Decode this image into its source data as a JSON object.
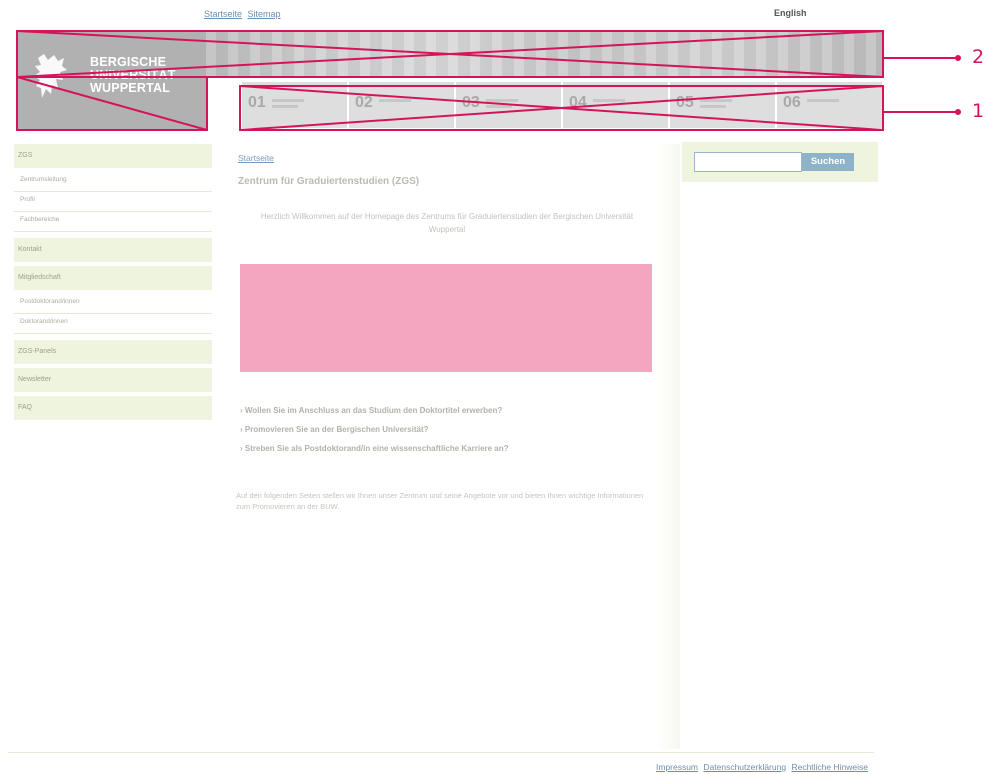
{
  "top_links": [
    "Startseite",
    "Sitemap"
  ],
  "language": "English",
  "logo": {
    "line1": "BERGISCHE",
    "line2": "UNIVERSITÄT",
    "line3": "WUPPERTAL"
  },
  "nav_tabs": [
    "01",
    "02",
    "03",
    "04",
    "05",
    "06"
  ],
  "annotations": {
    "label_1": "1",
    "label_2": "2",
    "color": "#d4145a"
  },
  "sidebar": {
    "items": [
      "ZGS",
      "Kontakt",
      "Mitgliedschaft",
      "ZGS-Panels",
      "Newsletter",
      "FAQ"
    ],
    "sub_zgs": [
      "Zentrumsleitung",
      "Profil",
      "Fachbereiche"
    ],
    "sub_mitgliedschaft": [
      "Postdoktorand/innen",
      "Doktorand/innen"
    ]
  },
  "main": {
    "breadcrumb": "Startseite",
    "title": "Zentrum für Graduiertenstudien (ZGS)",
    "welcome": "Herzlich Willkommen auf der Homepage des Zentrums für Graduiertenstudien der Bergischen Universität Wuppertal",
    "questions": [
      "Wollen Sie im Anschluss an das Studium den Doktortitel erwerben?",
      "Promovieren Sie an der Bergischen Universität?",
      "Streben Sie als Postdoktorand/in eine wissenschaftliche Karriere an?"
    ],
    "intro": "Auf den folgenden Seiten stellen wir Ihnen unser Zentrum und seine Angebote vor und bieten Ihnen wichtige Informationen zum Promovieren an der BUW."
  },
  "search": {
    "placeholder": "",
    "button": "Suchen"
  },
  "footer": [
    "Impressum",
    "Datenschutzerklärung",
    "Rechtliche Hinweise"
  ],
  "colors": {
    "accent": "#d4145a",
    "sidebar_bg": "#eef4de",
    "link": "#6b8fb0",
    "button": "#8eb3c9",
    "pink_box": "#f4a5c0"
  }
}
